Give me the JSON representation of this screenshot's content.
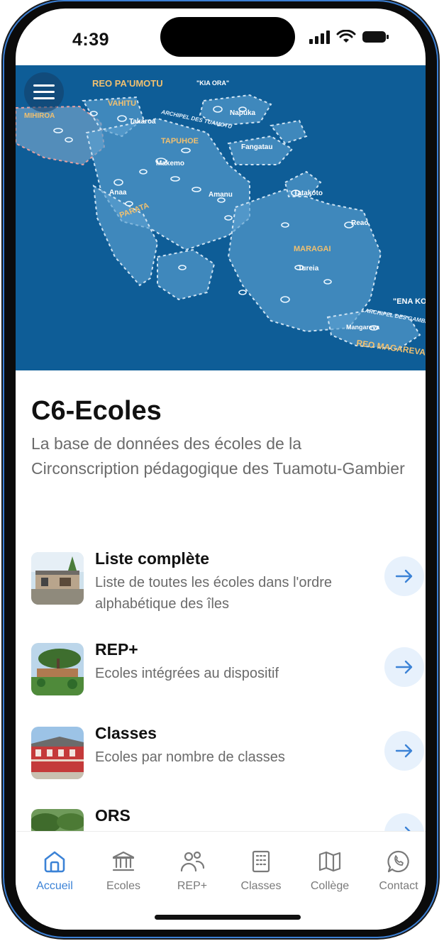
{
  "status_bar": {
    "time": "4:39"
  },
  "map": {
    "labels": {
      "reo_paumotu": "REO PA'UMOTU",
      "kia_ora": "\"KIA ORA\"",
      "vahitu": "VAHITU",
      "mihiroa": "MIHIROA",
      "tapuhoe": "TAPUHOE",
      "archipel_tuamotu": "ARCHIPEL DES TUAMOTU",
      "parata": "PARATA",
      "maragai": "MARAGAI",
      "napuka": "Napuka",
      "takaroa": "Takaroa",
      "fangatau": "Fangatau",
      "makemo": "Makemo",
      "amanu": "Amanu",
      "tatakoto": "Tatakoto",
      "reao": "Reao",
      "tureia": "Tureia",
      "anaa": "Anaa",
      "mangareva": "Mangareva",
      "ena_koto": "\"ENA KOTO",
      "archipel_gambier": "ARCHIPEL DES GAMBIER",
      "reo_magareva": "REO MAGAREVA"
    }
  },
  "header": {
    "title": "C6-Ecoles",
    "description": "La base de données des écoles de la Circonscription pédagogique des Tuamotu-Gambier"
  },
  "menu_items": [
    {
      "title": "Liste complète",
      "subtitle": "Liste de toutes les écoles dans l'ordre alphabétique des îles"
    },
    {
      "title": "REP+",
      "subtitle": "Ecoles intégrées au dispositif"
    },
    {
      "title": "Classes",
      "subtitle": "Ecoles par nombre de classes"
    },
    {
      "title": "ORS",
      "subtitle": ""
    }
  ],
  "tabs": [
    {
      "label": "Accueil",
      "icon": "home-icon"
    },
    {
      "label": "Ecoles",
      "icon": "bank-icon"
    },
    {
      "label": "REP+",
      "icon": "users-icon"
    },
    {
      "label": "Classes",
      "icon": "building-icon"
    },
    {
      "label": "Collège",
      "icon": "map-icon"
    },
    {
      "label": "Contact",
      "icon": "whatsapp-icon"
    }
  ],
  "colors": {
    "accent": "#3b82d6",
    "map_sea": "#0e5d97",
    "map_zone": "#5b9fd0"
  }
}
